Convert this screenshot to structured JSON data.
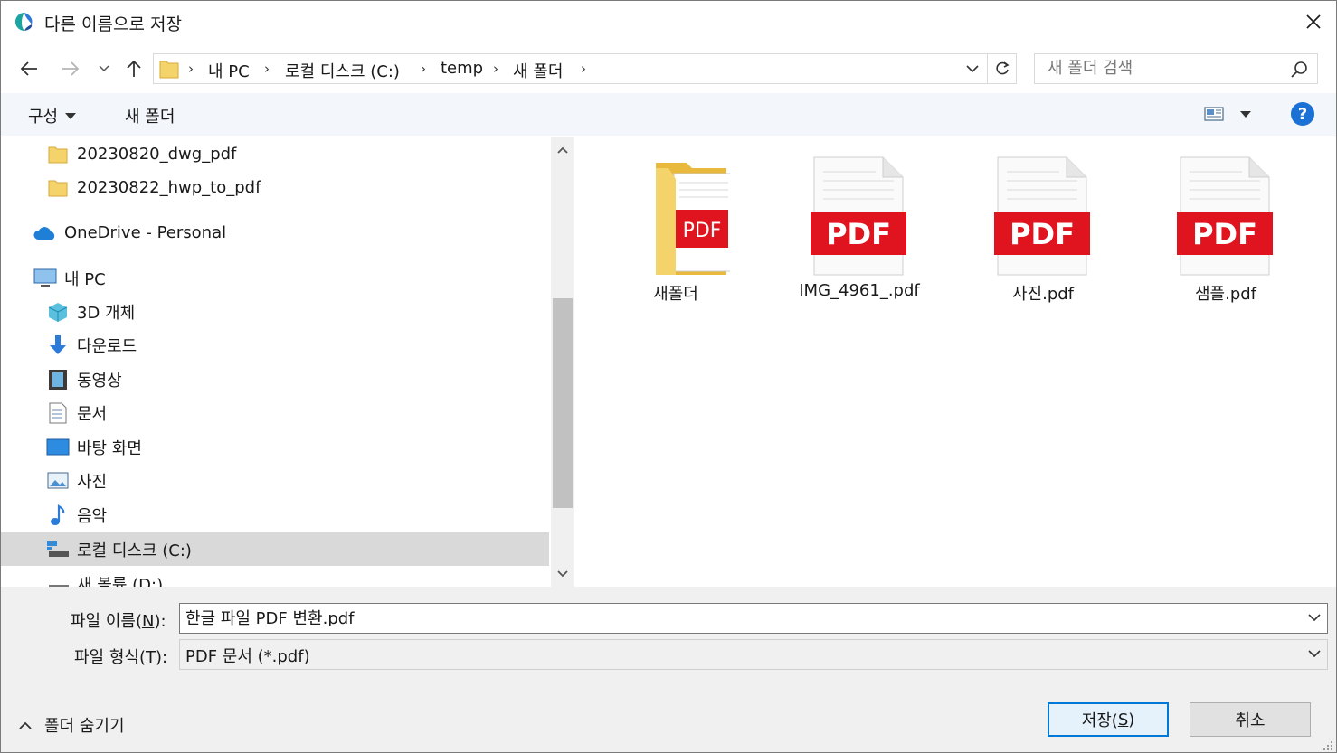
{
  "window": {
    "title": "다른 이름으로 저장"
  },
  "address": {
    "crumbs": [
      "내 PC",
      "로컬 디스크 (C:)",
      "temp",
      "새 폴더"
    ]
  },
  "search": {
    "placeholder": "새 폴더 검색"
  },
  "toolbar": {
    "organize_label": "구성",
    "new_folder_label": "새 폴더",
    "help_label": "?"
  },
  "nav": {
    "items": [
      {
        "label": "20230820_dwg_pdf",
        "icon": "folder-icon"
      },
      {
        "label": "20230822_hwp_to_pdf",
        "icon": "folder-icon"
      },
      {
        "label": "OneDrive - Personal",
        "icon": "onedrive-icon"
      },
      {
        "label": "내 PC",
        "icon": "pc-icon"
      },
      {
        "label": "3D 개체",
        "icon": "3d-objects-icon"
      },
      {
        "label": "다운로드",
        "icon": "download-icon"
      },
      {
        "label": "동영상",
        "icon": "video-icon"
      },
      {
        "label": "문서",
        "icon": "document-icon"
      },
      {
        "label": "바탕 화면",
        "icon": "desktop-icon"
      },
      {
        "label": "사진",
        "icon": "pictures-icon"
      },
      {
        "label": "음악",
        "icon": "music-icon"
      },
      {
        "label": "로컬 디스크 (C:)",
        "icon": "drive-icon",
        "selected": true
      },
      {
        "label": "새 볼륨 (D:)",
        "icon": "drive-icon"
      }
    ]
  },
  "files": [
    {
      "name": "새폴더",
      "kind": "folder-pdf",
      "pdf_label": "PDF"
    },
    {
      "name": "IMG_4961_.pdf",
      "kind": "pdf",
      "pdf_label": "PDF"
    },
    {
      "name": "사진.pdf",
      "kind": "pdf",
      "pdf_label": "PDF"
    },
    {
      "name": "샘플.pdf",
      "kind": "pdf",
      "pdf_label": "PDF"
    }
  ],
  "form": {
    "filename_label": "파일 이름(",
    "filename_key": "N",
    "filename_label_end": "):",
    "filename_value": "한글 파일 PDF 변환.pdf",
    "filetype_label": "파일 형식(",
    "filetype_key": "T",
    "filetype_label_end": "):",
    "filetype_value": "PDF 문서 (*.pdf)"
  },
  "footer": {
    "hide_folders_label": "폴더 숨기기",
    "save_label": "저장(",
    "save_key": "S",
    "save_label_end": ")",
    "cancel_label": "취소"
  },
  "colors": {
    "accent": "#0078d7",
    "pdf_red": "#e0141e",
    "folder_yellow": "#f5c842"
  }
}
